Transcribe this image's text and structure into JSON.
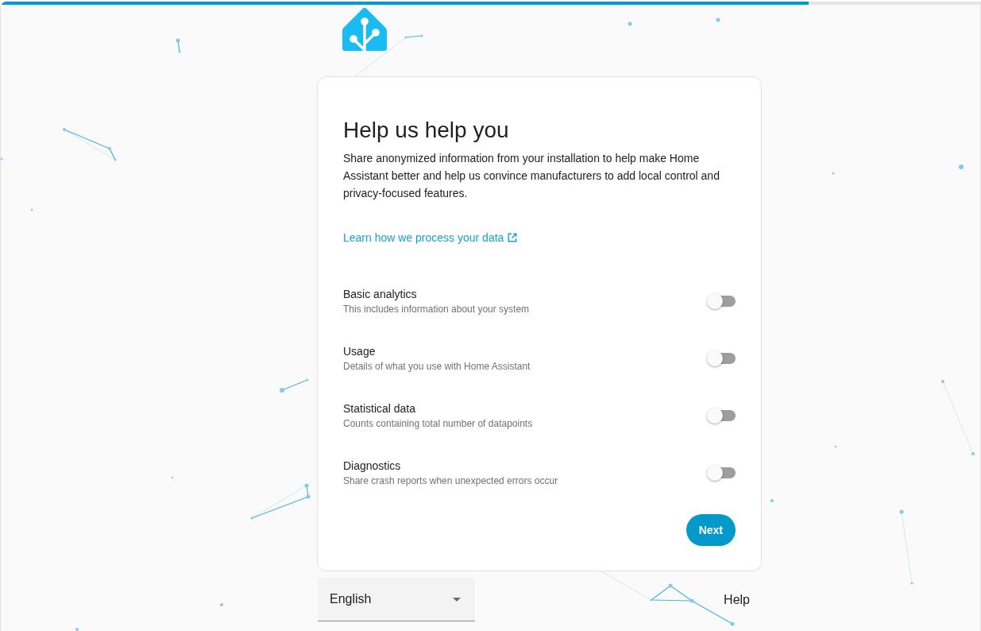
{
  "progress": {
    "level": 0.825
  },
  "card": {
    "title": "Help us help you",
    "description": "Share anonymized information from your installation to help make Home Assistant better and help us convince manufacturers to add local control and privacy-focused features.",
    "link": "Learn how we process your data",
    "options": [
      {
        "label": "Basic analytics",
        "description": "This includes information about your system",
        "on": false
      },
      {
        "label": "Usage",
        "description": "Details of what you use with Home Assistant",
        "on": false
      },
      {
        "label": "Statistical data",
        "description": "Counts containing total number of datapoints",
        "on": false
      },
      {
        "label": "Diagnostics",
        "description": "Share crash reports when unexpected errors occur",
        "on": false
      }
    ],
    "next_button": "Next"
  },
  "footer": {
    "language_select": {
      "value": "English"
    },
    "help_link": "Help"
  }
}
